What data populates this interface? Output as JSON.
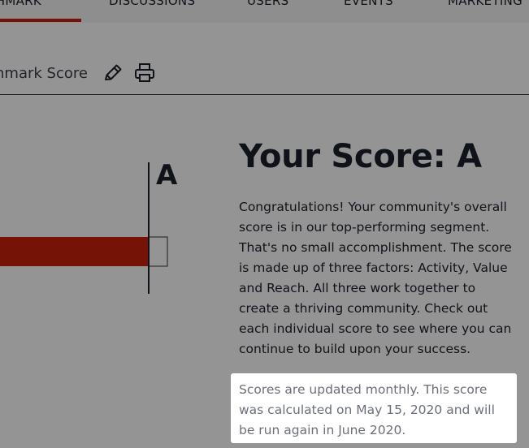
{
  "nav": {
    "tabs": [
      {
        "label": "CHMARK",
        "active": true
      },
      {
        "label": "DISCUSSIONS",
        "active": false
      },
      {
        "label": "USERS",
        "active": false
      },
      {
        "label": "EVENTS",
        "active": false
      },
      {
        "label": "MARKETING",
        "active": false
      }
    ]
  },
  "toolbar": {
    "title": "nmark Score",
    "edit_icon": "pencil-icon",
    "print_icon": "printer-icon"
  },
  "chart": {
    "grade_label": "A"
  },
  "score": {
    "heading": "Your Score: A",
    "body": "Congratulations! Your community's overall score is in our top-performing segment. That's no small accomplishment. The score is made up of three factors: Activity, Value and Reach. All three work together to create a thriving community. Check out each individual score to see where you can continue to build upon your success.",
    "note": "Scores are updated monthly. This score was calculated on May 15, 2020 and will be run again in June 2020."
  },
  "colors": {
    "accent": "#c8210b",
    "bar": "#c8210b",
    "text": "#1c1f2b",
    "note_text": "#6a6f7a"
  }
}
